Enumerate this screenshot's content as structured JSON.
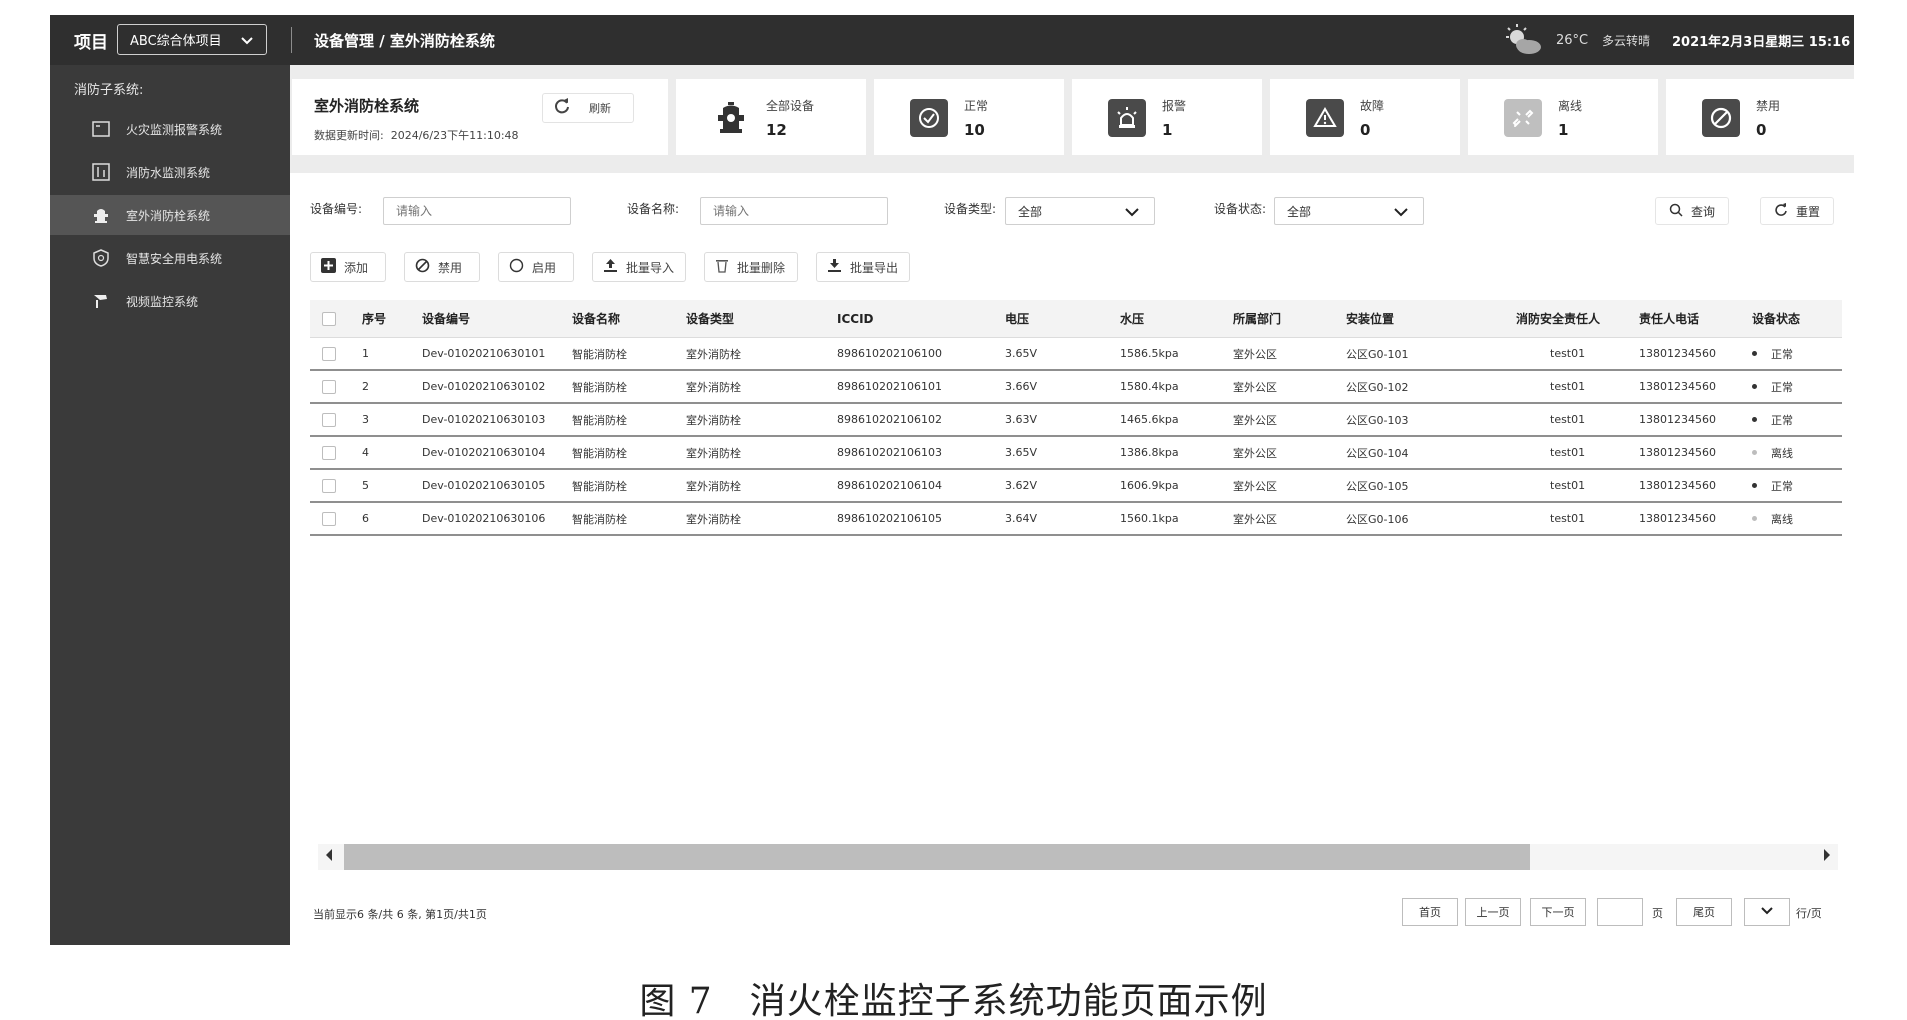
{
  "topbar": {
    "project_label": "项目",
    "project_value": "ABC综合体项目",
    "breadcrumb": "设备管理 / 室外消防栓系统",
    "temperature": "26°C",
    "weather": "多云转晴",
    "datetime": "2021年2月3日星期三 15:16"
  },
  "sidebar": {
    "section_label": "消防子系统:",
    "items": [
      {
        "label": "火灾监测报警系统",
        "icon": "alarm-panel-icon"
      },
      {
        "label": "消防水监测系统",
        "icon": "water-monitor-icon"
      },
      {
        "label": "室外消防栓系统",
        "icon": "hydrant-icon",
        "active": true
      },
      {
        "label": "智慧安全用电系统",
        "icon": "shield-icon"
      },
      {
        "label": "视频监控系统",
        "icon": "camera-icon"
      }
    ]
  },
  "header": {
    "title": "室外消防栓系统",
    "updated_label": "数据更新时间:",
    "updated_time": "2024/6/23下午11:10:48",
    "refresh_label": "刷新"
  },
  "stats": [
    {
      "label": "全部设备",
      "value": "12",
      "icon": "hydrant-icon"
    },
    {
      "label": "正常",
      "value": "10",
      "icon": "check-circle-icon"
    },
    {
      "label": "报警",
      "value": "1",
      "icon": "alarm-light-icon"
    },
    {
      "label": "故障",
      "value": "0",
      "icon": "warning-triangle-icon"
    },
    {
      "label": "离线",
      "value": "1",
      "icon": "broken-link-icon"
    },
    {
      "label": "禁用",
      "value": "0",
      "icon": "ban-icon"
    }
  ],
  "filters": {
    "device_no_label": "设备编号:",
    "device_no_placeholder": "请输入",
    "device_name_label": "设备名称:",
    "device_name_placeholder": "请输入",
    "device_type_label": "设备类型:",
    "device_type_value": "全部",
    "device_status_label": "设备状态:",
    "device_status_value": "全部",
    "search_label": "查询",
    "reset_label": "重置"
  },
  "toolbar": {
    "add": "添加",
    "disable": "禁用",
    "enable": "启用",
    "import": "批量导入",
    "delete": "批量删除",
    "export": "批量导出"
  },
  "table": {
    "headers": [
      "序号",
      "设备编号",
      "设备名称",
      "设备类型",
      "ICCID",
      "电压",
      "水压",
      "所属部门",
      "安装位置",
      "消防安全责任人",
      "责任人电话",
      "设备状态"
    ],
    "rows": [
      [
        "1",
        "Dev-01020210630101",
        "智能消防栓",
        "室外消防栓",
        "898610202106100",
        "3.65V",
        "1586.5kpa",
        "室外公区",
        "公区G0-101",
        "test01",
        "13801234560",
        "正常"
      ],
      [
        "2",
        "Dev-01020210630102",
        "智能消防栓",
        "室外消防栓",
        "898610202106101",
        "3.66V",
        "1580.4kpa",
        "室外公区",
        "公区G0-102",
        "test01",
        "13801234560",
        "正常"
      ],
      [
        "3",
        "Dev-01020210630103",
        "智能消防栓",
        "室外消防栓",
        "898610202106102",
        "3.63V",
        "1465.6kpa",
        "室外公区",
        "公区G0-103",
        "test01",
        "13801234560",
        "正常"
      ],
      [
        "4",
        "Dev-01020210630104",
        "智能消防栓",
        "室外消防栓",
        "898610202106103",
        "3.65V",
        "1386.8kpa",
        "室外公区",
        "公区G0-104",
        "test01",
        "13801234560",
        "离线"
      ],
      [
        "5",
        "Dev-01020210630105",
        "智能消防栓",
        "室外消防栓",
        "898610202106104",
        "3.62V",
        "1606.9kpa",
        "室外公区",
        "公区G0-105",
        "test01",
        "13801234560",
        "正常"
      ],
      [
        "6",
        "Dev-01020210630106",
        "智能消防栓",
        "室外消防栓",
        "898610202106105",
        "3.64V",
        "1560.1kpa",
        "室外公区",
        "公区G0-106",
        "test01",
        "13801234560",
        "离线"
      ]
    ]
  },
  "footer": {
    "info": "当前显示6 条/共 6 条, 第1页/共1页",
    "first": "首页",
    "prev": "上一页",
    "next": "下一页",
    "page_unit": "页",
    "last": "尾页",
    "per_page_unit": "行/页"
  },
  "caption": "图 7　消火栓监控子系统功能页面示例"
}
